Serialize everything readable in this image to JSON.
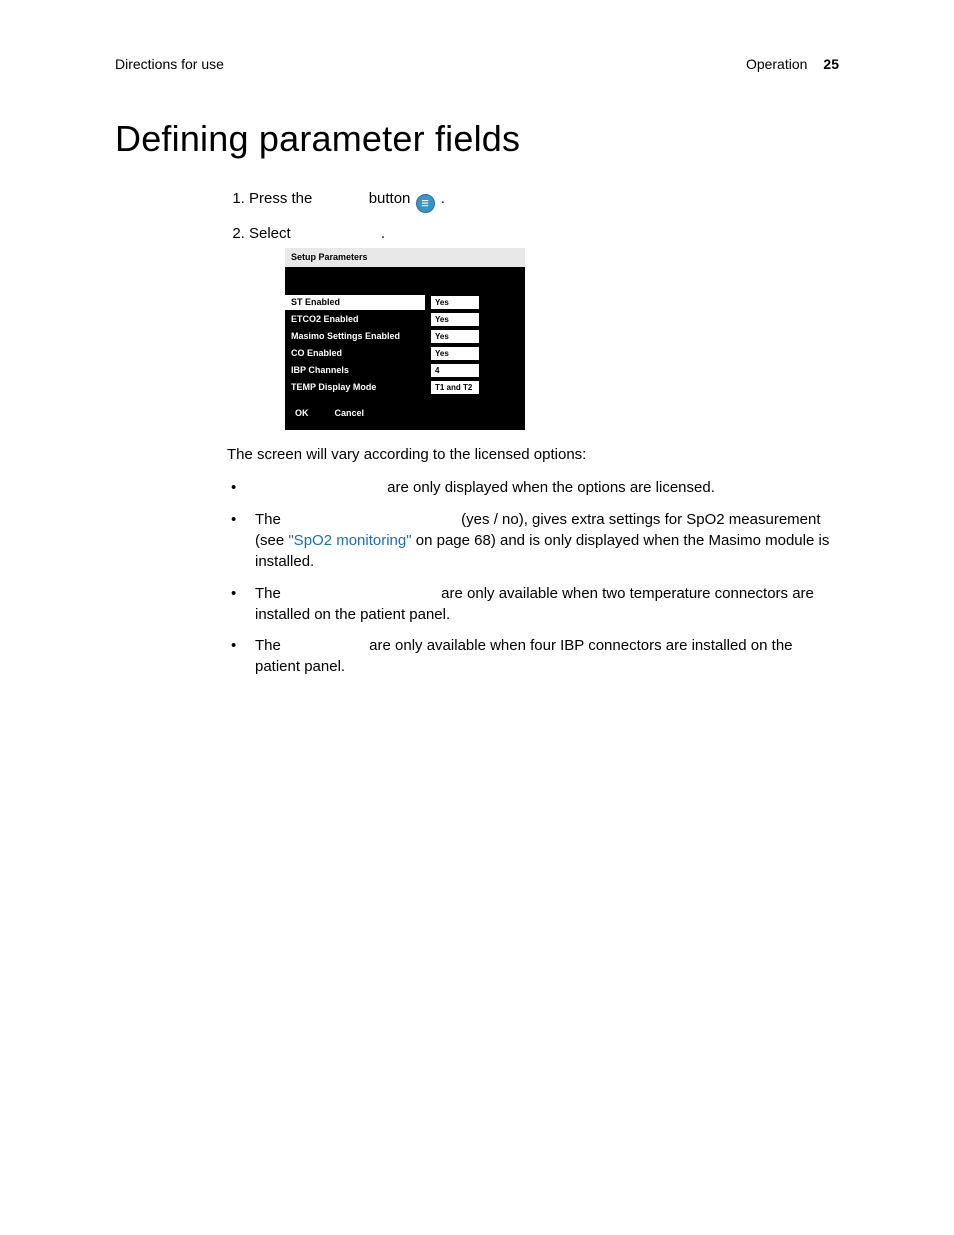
{
  "header": {
    "left": "Directions for use",
    "right_section": "Operation",
    "page_number": "25"
  },
  "title": "Defining parameter fields",
  "steps": {
    "item1_pre": "Press the ",
    "item1_post": " button ",
    "icon_glyph": "☰",
    "item2": "Select "
  },
  "screenshot": {
    "title": "Setup Parameters",
    "rows": [
      {
        "label": "ST Enabled",
        "value": "Yes",
        "highlight": true
      },
      {
        "label": "ETCO2 Enabled",
        "value": "Yes",
        "highlight": false
      },
      {
        "label": "Masimo Settings Enabled",
        "value": "Yes",
        "highlight": false
      },
      {
        "label": "CO Enabled",
        "value": "Yes",
        "highlight": false
      },
      {
        "label": "IBP Channels",
        "value": "4",
        "highlight": false
      },
      {
        "label": "TEMP Display Mode",
        "value": "T1 and T2",
        "highlight": false
      }
    ],
    "ok": "OK",
    "cancel": "Cancel"
  },
  "para_after_shot": "The screen will vary according to the licensed options:",
  "bullets": {
    "b1": " are only displayed when the options are licensed.",
    "b2_pre": "The ",
    "b2_mid": " (yes / no), gives extra settings for SpO2 measurement (see ",
    "b2_link": "\"SpO2 monitoring\"",
    "b2_post": " on page 68) and is only displayed when the Masimo module is installed.",
    "b3_pre": "The ",
    "b3_post": " are only available when two temperature connectors are installed on the patient panel.",
    "b4_pre": "The ",
    "b4_post": " are only available when four IBP connectors are installed on the patient panel."
  }
}
